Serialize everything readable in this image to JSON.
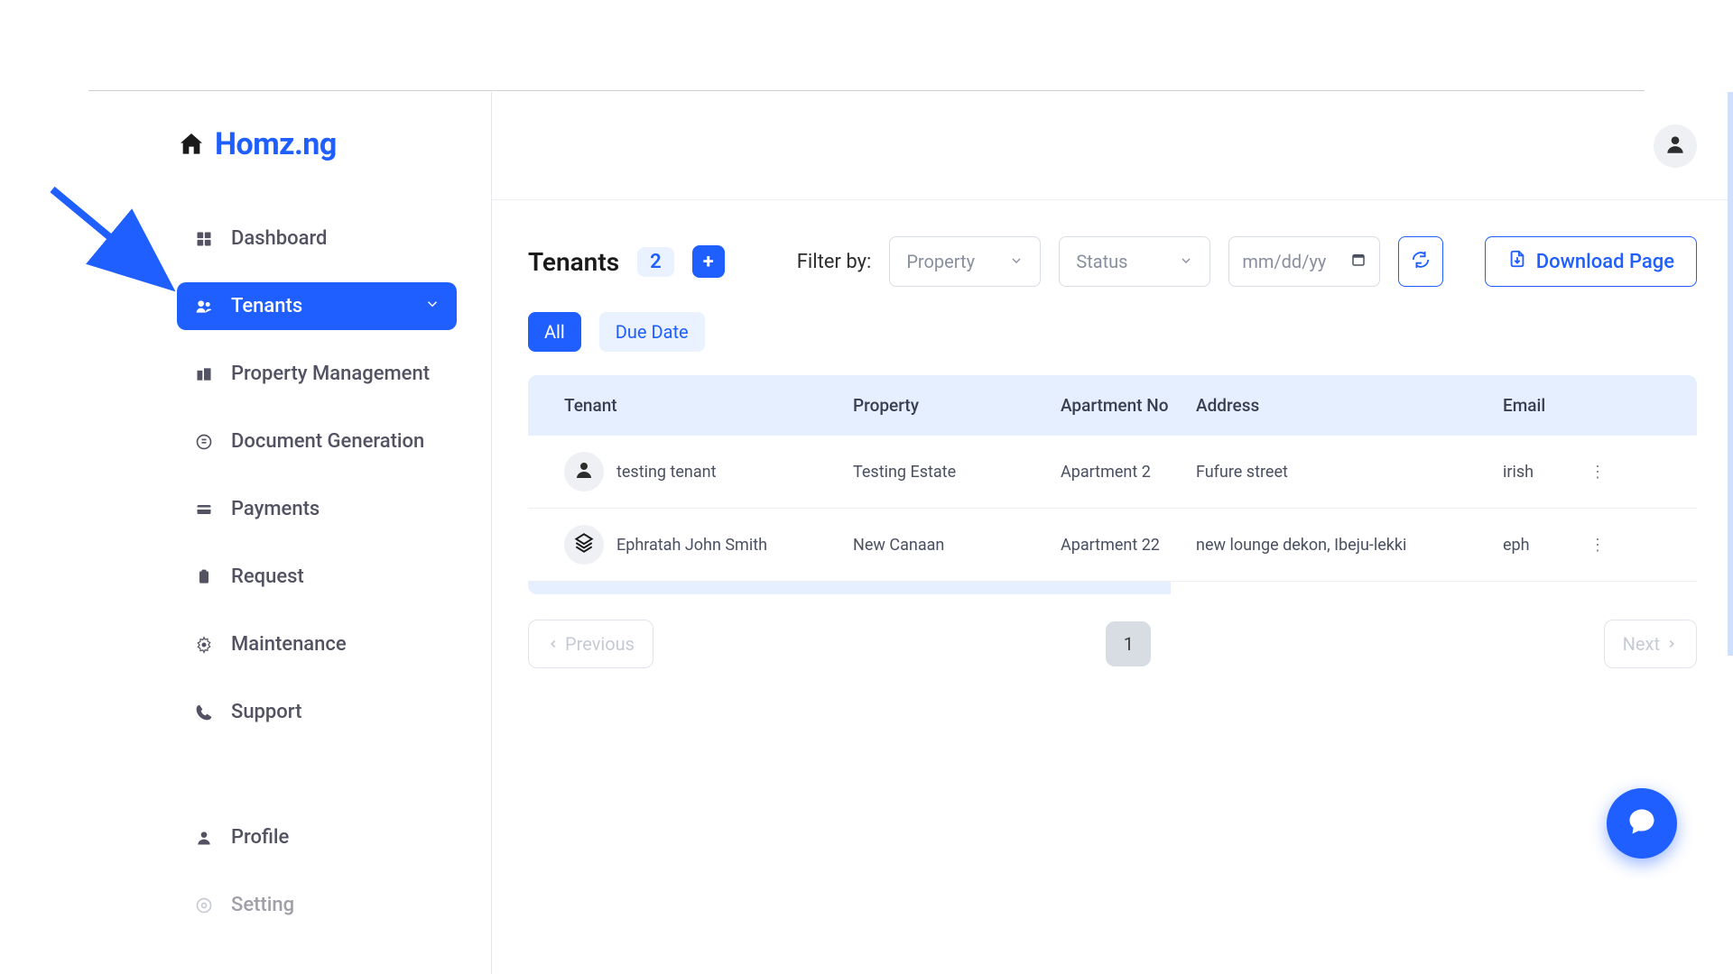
{
  "brand": {
    "name": "Homz.ng"
  },
  "sidebar": {
    "items": [
      {
        "label": "Dashboard"
      },
      {
        "label": "Tenants"
      },
      {
        "label": "Property Management"
      },
      {
        "label": "Document Generation"
      },
      {
        "label": "Payments"
      },
      {
        "label": "Request"
      },
      {
        "label": "Maintenance"
      },
      {
        "label": "Support"
      },
      {
        "label": "Profile"
      },
      {
        "label": "Setting"
      }
    ]
  },
  "tenants": {
    "title": "Tenants",
    "count": "2",
    "filter_label": "Filter by:",
    "property_placeholder": "Property",
    "status_placeholder": "Status",
    "date_placeholder": "mm/dd/yy",
    "download_label": "Download Page",
    "tabs": {
      "all": "All",
      "due": "Due Date"
    },
    "columns": {
      "tenant": "Tenant",
      "property": "Property",
      "apartment": "Apartment No",
      "address": "Address",
      "email": "Email"
    },
    "rows": [
      {
        "name": "testing tenant",
        "property": "Testing Estate",
        "apartment": "Apartment 2",
        "address": "Fufure street",
        "email": "irish"
      },
      {
        "name": "Ephratah John Smith",
        "property": "New Canaan",
        "apartment": "Apartment 22",
        "address": "new lounge dekon, Ibeju-lekki",
        "email": "eph"
      }
    ],
    "pagination": {
      "prev": "Previous",
      "page": "1",
      "next": "Next"
    }
  }
}
